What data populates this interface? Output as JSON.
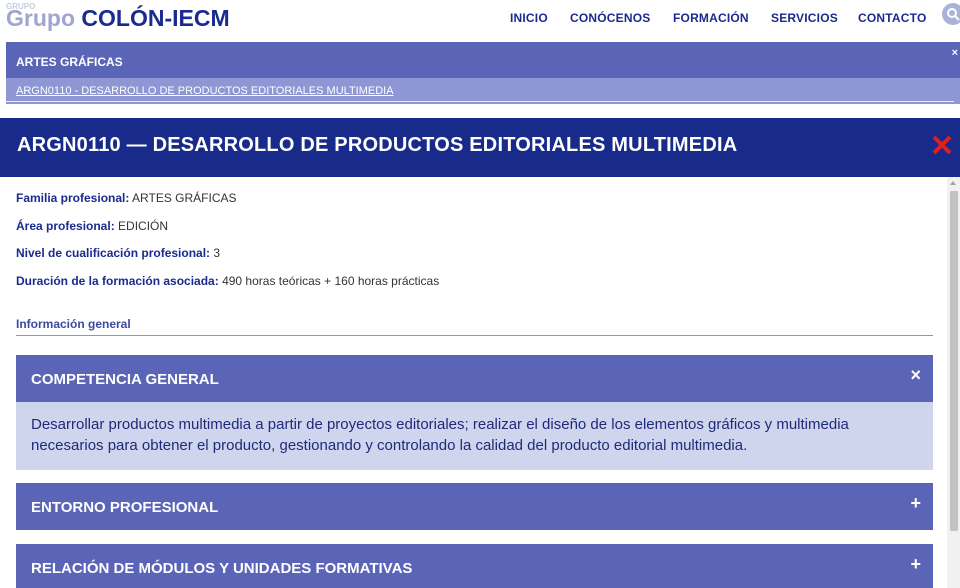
{
  "brand": {
    "prefix": "Grupo",
    "name": "COLÓN-IECM",
    "ghost": "GRUPO"
  },
  "nav": {
    "items": [
      "INICIO",
      "CONÓCENOS",
      "FORMACIÓN",
      "SERVICIOS",
      "CONTACTO"
    ],
    "search_icon": "search-icon"
  },
  "breadcrumb": {
    "heading": "ARTES GRÁFICAS",
    "link": "ARGN0110 - DESARROLLO DE PRODUCTOS EDITORIALES MULTIMEDIA",
    "close": "×"
  },
  "title": "ARGN0110 — DESARROLLO DE PRODUCTOS EDITORIALES MULTIMEDIA",
  "details": [
    {
      "label": "Familia profesional:",
      "value": "ARTES GRÁFICAS"
    },
    {
      "label": "Área profesional:",
      "value": "EDICIÓN"
    },
    {
      "label": "Nivel de cualificación profesional:",
      "value": "3"
    },
    {
      "label": "Duración de la formación asociada:",
      "value": "490 horas teóricas + 160 horas prácticas"
    }
  ],
  "section_label": "Información general",
  "accordions": [
    {
      "title": "COMPETENCIA GENERAL",
      "toggle": "×",
      "expanded": true,
      "body": "Desarrollar productos multimedia a partir de proyectos editoriales; realizar el diseño de los elementos gráficos y multimedia necesarios para obtener el producto, gestionando y controlando la calidad del producto editorial multimedia."
    },
    {
      "title": "ENTORNO PROFESIONAL",
      "toggle": "+",
      "expanded": false
    },
    {
      "title": "RELACIÓN DE MÓDULOS Y UNIDADES FORMATIVAS",
      "toggle": "+",
      "expanded": false
    }
  ],
  "colors": {
    "navy": "#182a8a",
    "accent": "#5a65b8",
    "light": "#d0d5ee",
    "close_red": "#e02020"
  }
}
